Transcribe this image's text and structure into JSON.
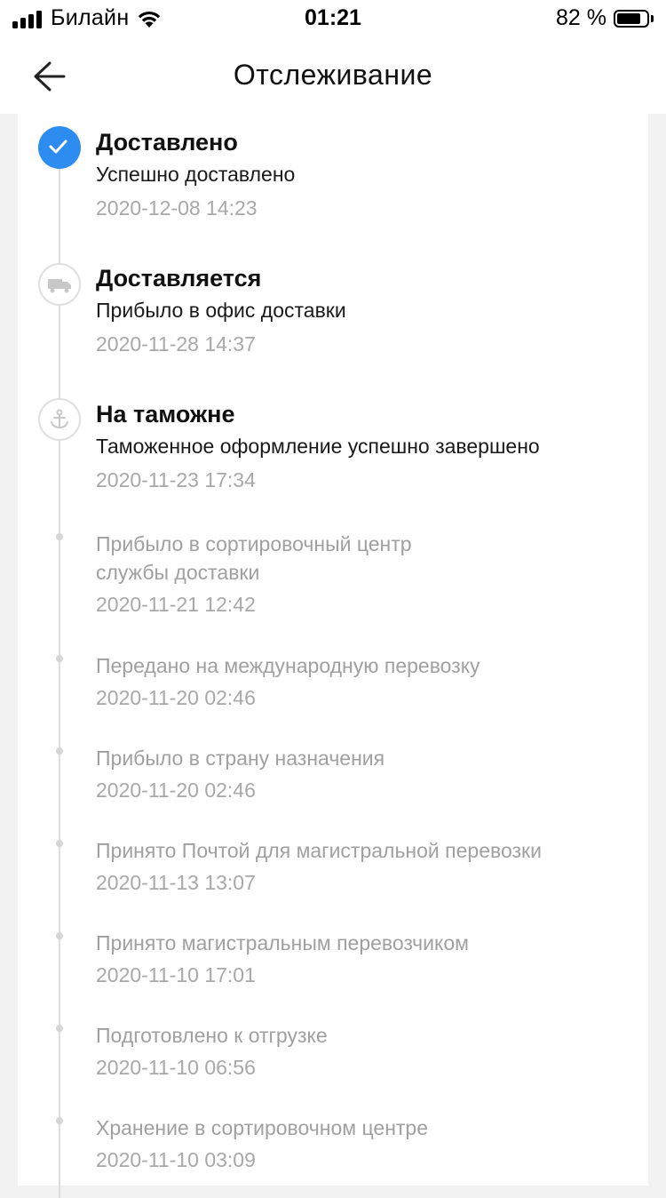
{
  "status_bar": {
    "carrier": "Билайн",
    "time": "01:21",
    "battery_pct": "82 %",
    "battery_level": 0.82
  },
  "header": {
    "title": "Отслеживание",
    "back_icon": "arrow-left-icon"
  },
  "colors": {
    "accent": "#2d8cf0",
    "muted_text": "#a8a8a8",
    "line": "#dcdcdc"
  },
  "timeline": {
    "major": [
      {
        "title": "Доставлено",
        "desc": "Успешно доставлено",
        "date": "2020-12-08 14:23",
        "icon": "check-icon"
      },
      {
        "title": "Доставляется",
        "desc": "Прибыло в офис доставки",
        "date": "2020-11-28 14:37",
        "icon": "truck-icon"
      },
      {
        "title": "На таможне",
        "desc": "Таможенное оформление успешно завершено",
        "date": "2020-11-23 17:34",
        "icon": "anchor-icon"
      }
    ],
    "minor": [
      {
        "desc_line1": "Прибыло в сортировочный центр",
        "desc_line2": "службы доставки",
        "date": "2020-11-21 12:42"
      },
      {
        "desc": "Передано на международную перевозку",
        "date": "2020-11-20 02:46"
      },
      {
        "desc": "Прибыло в страну назначения",
        "date": "2020-11-20 02:46"
      },
      {
        "desc": "Принято Почтой для магистральной перевозки",
        "date": "2020-11-13 13:07"
      },
      {
        "desc": "Принято магистральным перевозчиком",
        "date": "2020-11-10 17:01"
      },
      {
        "desc": "Подготовлено к отгрузке",
        "date": "2020-11-10 06:56"
      },
      {
        "desc": "Хранение в сортировочном центре",
        "date": "2020-11-10 03:09"
      }
    ]
  }
}
